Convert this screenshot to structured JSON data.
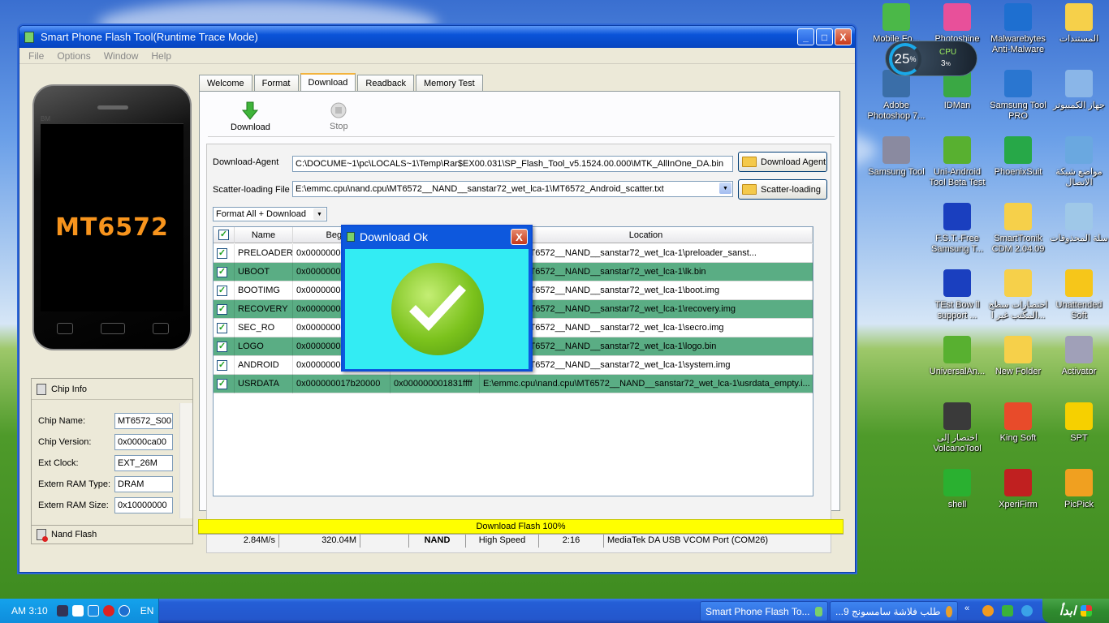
{
  "window": {
    "title": "Smart Phone Flash Tool(Runtime Trace Mode)",
    "controls": {
      "minimize": "_",
      "maximize": "□",
      "close": "X"
    },
    "menu": [
      "File",
      "Options",
      "Window",
      "Help"
    ]
  },
  "phone": {
    "brand": "BM",
    "chip_label": "MT6572"
  },
  "chip_info": {
    "header": "Chip Info",
    "rows": [
      {
        "label": "Chip Name:",
        "value": "MT6572_S00"
      },
      {
        "label": "Chip Version:",
        "value": "0x0000ca00"
      },
      {
        "label": "Ext Clock:",
        "value": "EXT_26M"
      },
      {
        "label": "Extern RAM Type:",
        "value": "DRAM"
      },
      {
        "label": "Extern RAM Size:",
        "value": "0x10000000"
      }
    ],
    "nand_flash": "Nand Flash"
  },
  "tabs": [
    "Welcome",
    "Format",
    "Download",
    "Readback",
    "Memory Test"
  ],
  "active_tab": "Download",
  "toolbar": {
    "download": "Download",
    "stop": "Stop"
  },
  "download_agent": {
    "label": "Download-Agent",
    "value": "C:\\DOCUME~1\\pc\\LOCALS~1\\Temp\\Rar$EX00.031\\SP_Flash_Tool_v5.1524.00.000\\MTK_AllInOne_DA.bin",
    "button": "Download Agent"
  },
  "scatter": {
    "label": "Scatter-loading File",
    "value": "E:\\emmc.cpu\\nand.cpu\\MT6572__NAND__sanstar72_wet_lca-1\\MT6572_Android_scatter.txt",
    "button": "Scatter-loading"
  },
  "mode_select": "Format All + Download",
  "table": {
    "headers": {
      "name": "Name",
      "begin": "Begin A",
      "end": "",
      "location": "Location"
    },
    "rows": [
      {
        "name": "PRELOADER",
        "begin": "0x00000000",
        "end": "",
        "location": "nand.cpu\\MT6572__NAND__sanstar72_wet_lca-1\\preloader_sanst...",
        "green": false
      },
      {
        "name": "UBOOT",
        "begin": "0x00000000",
        "end": "",
        "location": "nand.cpu\\MT6572__NAND__sanstar72_wet_lca-1\\lk.bin",
        "green": true
      },
      {
        "name": "BOOTIMG",
        "begin": "0x00000000",
        "end": "",
        "location": "nand.cpu\\MT6572__NAND__sanstar72_wet_lca-1\\boot.img",
        "green": false
      },
      {
        "name": "RECOVERY",
        "begin": "0x00000000",
        "end": "",
        "location": "nand.cpu\\MT6572__NAND__sanstar72_wet_lca-1\\recovery.img",
        "green": true
      },
      {
        "name": "SEC_RO",
        "begin": "0x00000000",
        "end": "",
        "location": "nand.cpu\\MT6572__NAND__sanstar72_wet_lca-1\\secro.img",
        "green": false
      },
      {
        "name": "LOGO",
        "begin": "0x00000000",
        "end": "",
        "location": "nand.cpu\\MT6572__NAND__sanstar72_wet_lca-1\\logo.bin",
        "green": true
      },
      {
        "name": "ANDROID",
        "begin": "0x00000000",
        "end": "",
        "location": "nand.cpu\\MT6572__NAND__sanstar72_wet_lca-1\\system.img",
        "green": false
      },
      {
        "name": "USRDATA",
        "begin": "0x000000017b20000",
        "end": "0x000000001831ffff",
        "location": "E:\\emmc.cpu\\nand.cpu\\MT6572__NAND__sanstar72_wet_lca-1\\usrdata_empty.i...",
        "green": true
      }
    ]
  },
  "progress": {
    "text": "Download Flash 100%",
    "value": 1.0
  },
  "status": [
    "2.84M/s",
    "320.04M",
    "NAND",
    "High Speed",
    "2:16",
    "MediaTek DA USB VCOM Port (COM26)"
  ],
  "dialog": {
    "title": "Download Ok",
    "close": "X"
  },
  "gadget": {
    "percent": "25",
    "unit": "%",
    "label": "CPU",
    "sub": "3",
    "sub_unit": "%"
  },
  "desktop_icons": [
    {
      "label": "Mobile Fo...",
      "color": "#4bb848"
    },
    {
      "label": "Photoshine",
      "color": "#e8509a"
    },
    {
      "label": "Malwarebytes Anti-Malware",
      "color": "#1e6fd0"
    },
    {
      "label": "المستندات",
      "color": "#f6d04a"
    },
    {
      "label": "Adobe Photoshop 7...",
      "color": "#3a6ea8"
    },
    {
      "label": "IDMan",
      "color": "#3aa844"
    },
    {
      "label": "Samsung Tool PRO",
      "color": "#2a76d0"
    },
    {
      "label": "جهاز الكمبيوتر",
      "color": "#8ab6e8"
    },
    {
      "label": "Samsung Tool",
      "color": "#8a8aa0"
    },
    {
      "label": "Uni-Android Tool Beta Test",
      "color": "#58b030"
    },
    {
      "label": "PhoenixSuit",
      "color": "#27a848"
    },
    {
      "label": "مواضع شبكة الاتصال",
      "color": "#6aa8e0"
    },
    {
      "label": "F.S.T.-Free Samsung T...",
      "color": "#1a3fbf"
    },
    {
      "label": "SmartTronik CDM 2.04.09",
      "color": "#f6d04a"
    },
    {
      "label": "سلة المحذوفات",
      "color": "#9fc8e8"
    },
    {
      "label": "TEst Bow ll support ...",
      "color": "#1a3fbf"
    },
    {
      "label": "اختصارات سطح المكتب غير ا...",
      "color": "#f6d04a"
    },
    {
      "label": "Unattended Soft",
      "color": "#f6c61a"
    },
    {
      "label": "UniversalAn...",
      "color": "#58b030"
    },
    {
      "label": "New Folder",
      "color": "#f6d04a"
    },
    {
      "label": "Activator",
      "color": "#a0a0b8"
    },
    {
      "label": "اختصار إلى VolcanoTool",
      "color": "#3a3a3a"
    },
    {
      "label": "King Soft",
      "color": "#e84b2a"
    },
    {
      "label": "SPT",
      "color": "#f6d000"
    },
    {
      "label": "shell",
      "color": "#2ab030"
    },
    {
      "label": "XperiFirm",
      "color": "#c02020"
    },
    {
      "label": "PicPick",
      "color": "#f0a020"
    }
  ],
  "taskbar": {
    "time": "AM 3:10",
    "lang": "EN",
    "task1": "Smart Phone Flash To...",
    "task2": "طلب فلاشة سامسونج 9...",
    "start": "ابدأ"
  }
}
